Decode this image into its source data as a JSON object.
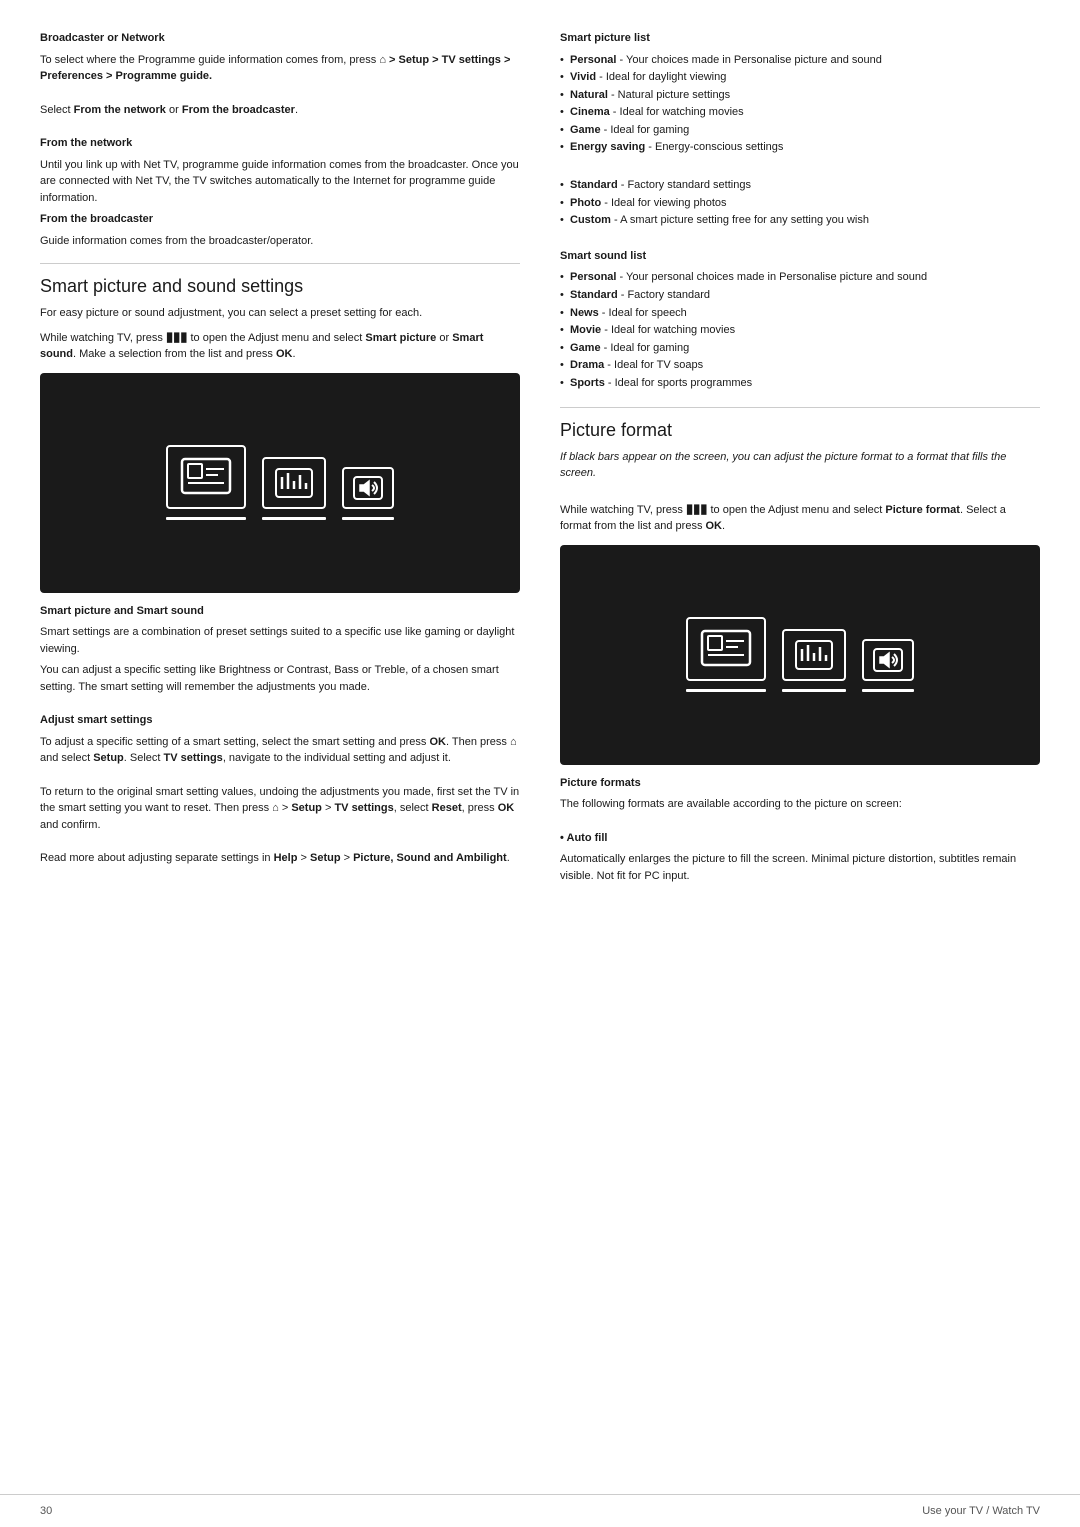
{
  "page_number": "30",
  "footer_right": "Use your TV / Watch TV",
  "left_col": {
    "broadcaster_section": {
      "title": "Broadcaster or Network",
      "para1": "To select where the Programme guide information comes from, press",
      "path": "> Setup > TV settings > Preferences > Programme guide.",
      "para2_label": "Select ",
      "para2_from_network": "From the network",
      "para2_or": " or ",
      "para2_from_broadcaster": "From the broadcaster",
      "para2_end": "."
    },
    "from_network": {
      "title": "From the network",
      "body": "Until you link up with Net TV, programme guide information comes from the broadcaster. Once you are connected with Net TV, the TV switches automatically to the Internet for programme guide information."
    },
    "from_broadcaster": {
      "title": "From the broadcaster",
      "body": "Guide information comes from the broadcaster/operator."
    },
    "smart_section": {
      "section_title": "Smart picture and sound settings",
      "para1": "For easy picture or sound adjustment, you can select a preset setting for each.",
      "para2_start": "While watching TV, press ",
      "para2_end": " to open the Adjust menu and select ",
      "smart_picture": "Smart picture",
      "or": " or ",
      "smart_sound": "Smart sound",
      "para2_tail": ". Make a selection from the list and press ",
      "ok": "OK",
      "para2_close": "."
    },
    "smart_picture_sound": {
      "title": "Smart picture and Smart sound",
      "body1": "Smart settings are a combination of preset settings suited to a specific use like gaming or daylight viewing.",
      "body2": "You can adjust a specific setting like Brightness or Contrast, Bass or Treble, of a chosen smart setting. The smart setting will remember the adjustments you made."
    },
    "adjust_smart": {
      "title": "Adjust smart settings",
      "body1_start": "To adjust a specific setting of a smart setting, select the smart setting and press ",
      "ok": "OK",
      "body1_mid": ". Then press ",
      "home": " and select ",
      "setup": "Setup",
      "body1_cont": ". Select ",
      "tv_settings": "TV settings",
      "body1_tail": ", navigate to the individual setting and adjust it.",
      "body2_start": "To return to the original smart setting values, undoing the adjustments you made, first set the TV in the smart setting you want to reset. Then press ",
      "home2": " > ",
      "setup2": "Setup",
      "body2_mid": " > ",
      "tv_settings2": "TV settings",
      "body2_cont": ", select ",
      "reset": "Reset",
      "body2_tail": ", press ",
      "ok2": "OK",
      "body2_end": " and confirm.",
      "body3_start": "Read more about adjusting separate settings in ",
      "help": "Help",
      "body3_mid": " > ",
      "setup3": "Setup",
      "body3_tail": " > Picture, Sound and Ambilight.",
      "picture_sound_ambilight": "Picture, Sound and Ambilight"
    }
  },
  "right_col": {
    "smart_picture_list": {
      "title": "Smart picture list",
      "items": [
        {
          "label": "Personal",
          "desc": " - Your choices made in Personalise picture and sound"
        },
        {
          "label": "Vivid",
          "desc": " - Ideal for daylight viewing"
        },
        {
          "label": "Natural",
          "desc": " - Natural picture settings"
        },
        {
          "label": "Cinema",
          "desc": " - Ideal for watching movies"
        },
        {
          "label": "Game",
          "desc": " - Ideal for gaming"
        },
        {
          "label": "Energy saving",
          "desc": " - Energy-conscious settings"
        }
      ],
      "items2": [
        {
          "label": "Standard",
          "desc": " - Factory standard settings"
        },
        {
          "label": "Photo",
          "desc": " - Ideal for viewing photos"
        },
        {
          "label": "Custom",
          "desc": " - A smart picture setting free for any setting you wish"
        }
      ]
    },
    "smart_sound_list": {
      "title": "Smart sound list",
      "items": [
        {
          "label": "Personal",
          "desc": " - Your personal choices made in Personalise picture and sound"
        },
        {
          "label": "Standard",
          "desc": " - Factory standard"
        },
        {
          "label": "News",
          "desc": " - Ideal for speech"
        },
        {
          "label": "Movie",
          "desc": " - Ideal for watching movies"
        },
        {
          "label": "Game",
          "desc": " - Ideal for gaming"
        },
        {
          "label": "Drama",
          "desc": " - Ideal for TV soaps"
        },
        {
          "label": "Sports",
          "desc": " - Ideal for sports programmes"
        }
      ]
    },
    "picture_format": {
      "section_title": "Picture format",
      "italic_text": "If black bars appear on the screen, you can adjust the picture format to a format that fills the screen.",
      "para1_start": "While watching TV, press ",
      "para1_end": " to open the Adjust menu and select ",
      "picture_format_bold": "Picture format",
      "para1_tail": ". Select a format from the list and press ",
      "ok": "OK",
      "para1_close": "."
    },
    "picture_formats": {
      "title": "Picture formats",
      "body": "The following formats are available according to the picture on screen:",
      "auto_fill_title": "• Auto fill",
      "auto_fill_body": "Automatically enlarges the picture to fill the screen. Minimal picture distortion, subtitles remain visible. Not fit for PC input."
    }
  }
}
